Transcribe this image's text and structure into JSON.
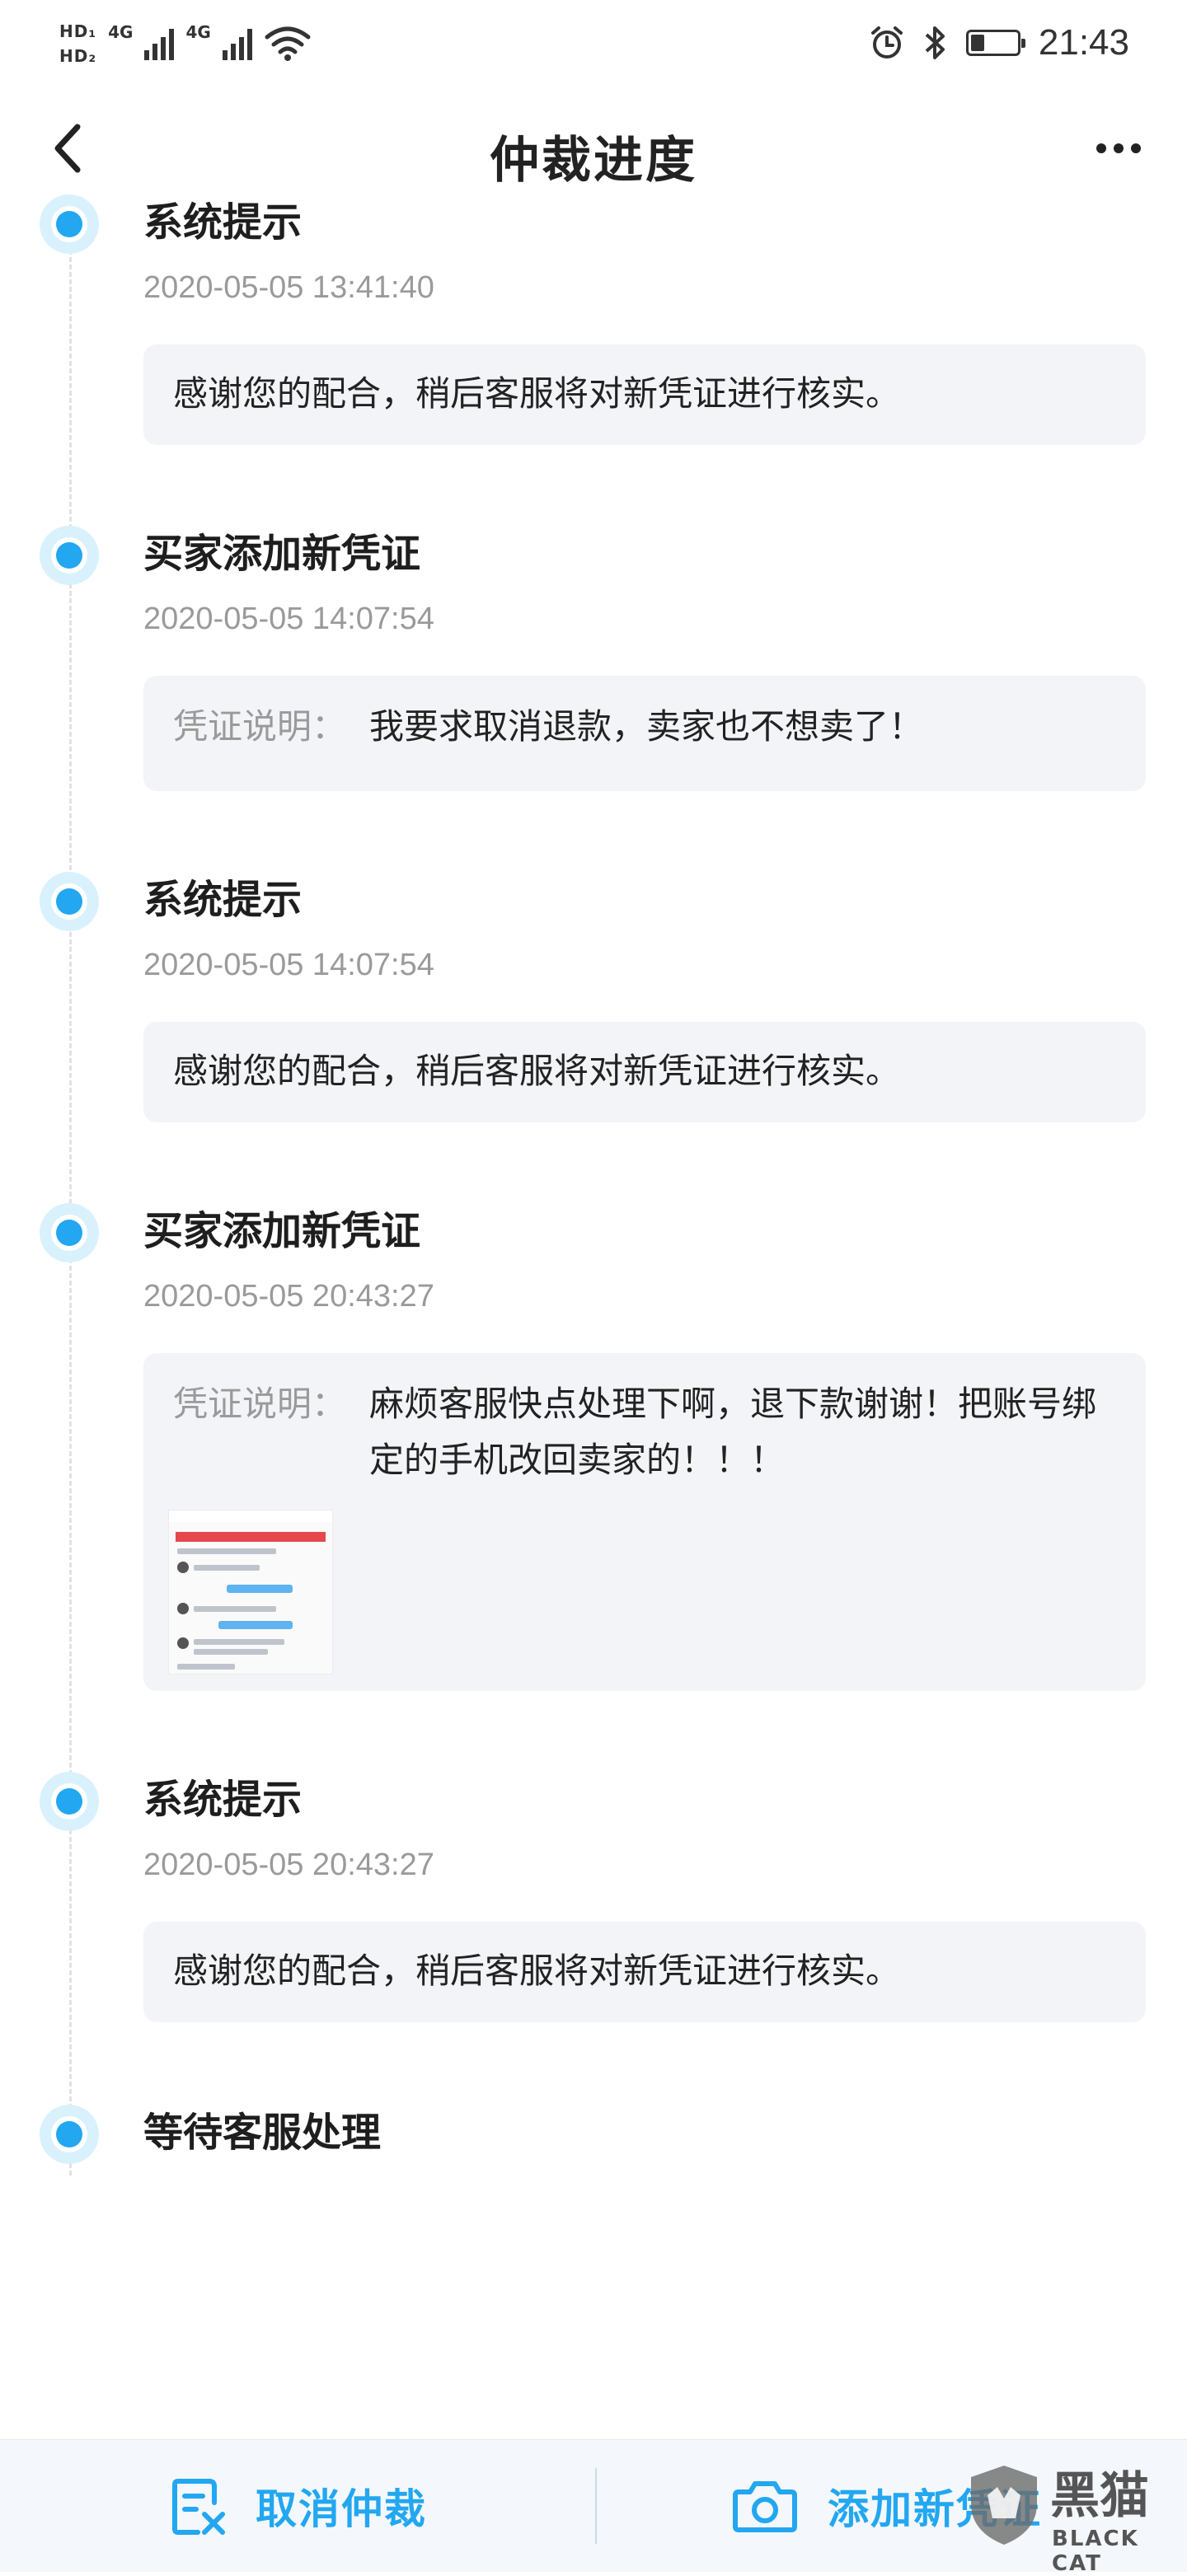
{
  "status_bar": {
    "hd1": "HD₁",
    "hd2": "HD₂",
    "net1": "4G",
    "net2": "4G",
    "time": "21:43",
    "battery_level": 0.3,
    "icons": [
      "alarm-icon",
      "bluetooth-icon",
      "wifi-icon",
      "battery-icon"
    ]
  },
  "nav": {
    "title": "仲裁进度",
    "back_icon": "back-chevron-icon",
    "more_icon": "more-dots-icon"
  },
  "timeline": [
    {
      "title": "系统提示",
      "time": "2020-05-05 13:41:40",
      "text": "感谢您的配合，稍后客服将对新凭证进行核实。"
    },
    {
      "title": "买家添加新凭证",
      "time": "2020-05-05 14:07:54",
      "label": "凭证说明：",
      "text": "我要求取消退款，卖家也不想卖了！"
    },
    {
      "title": "系统提示",
      "time": "2020-05-05 14:07:54",
      "text": "感谢您的配合，稍后客服将对新凭证进行核实。"
    },
    {
      "title": "买家添加新凭证",
      "time": "2020-05-05 20:43:27",
      "label": "凭证说明：",
      "text": "麻烦客服快点处理下啊，退下款谢谢！把账号绑定的手机改回卖家的！！！"
    },
    {
      "title": "系统提示",
      "time": "2020-05-05 20:43:27",
      "text": "感谢您的配合，稍后客服将对新凭证进行核实。"
    },
    {
      "title": "等待客服处理"
    }
  ],
  "bottom_bar": {
    "cancel_label": "取消仲裁",
    "add_label": "添加新凭证"
  },
  "watermark": {
    "text": "黑猫",
    "sub": "BLACK CAT"
  },
  "colors": {
    "accent": "#22a7f0",
    "card_bg": "#f3f4f8",
    "time_text": "#9a9a9a",
    "bottom_bg": "#f4f7fb"
  }
}
